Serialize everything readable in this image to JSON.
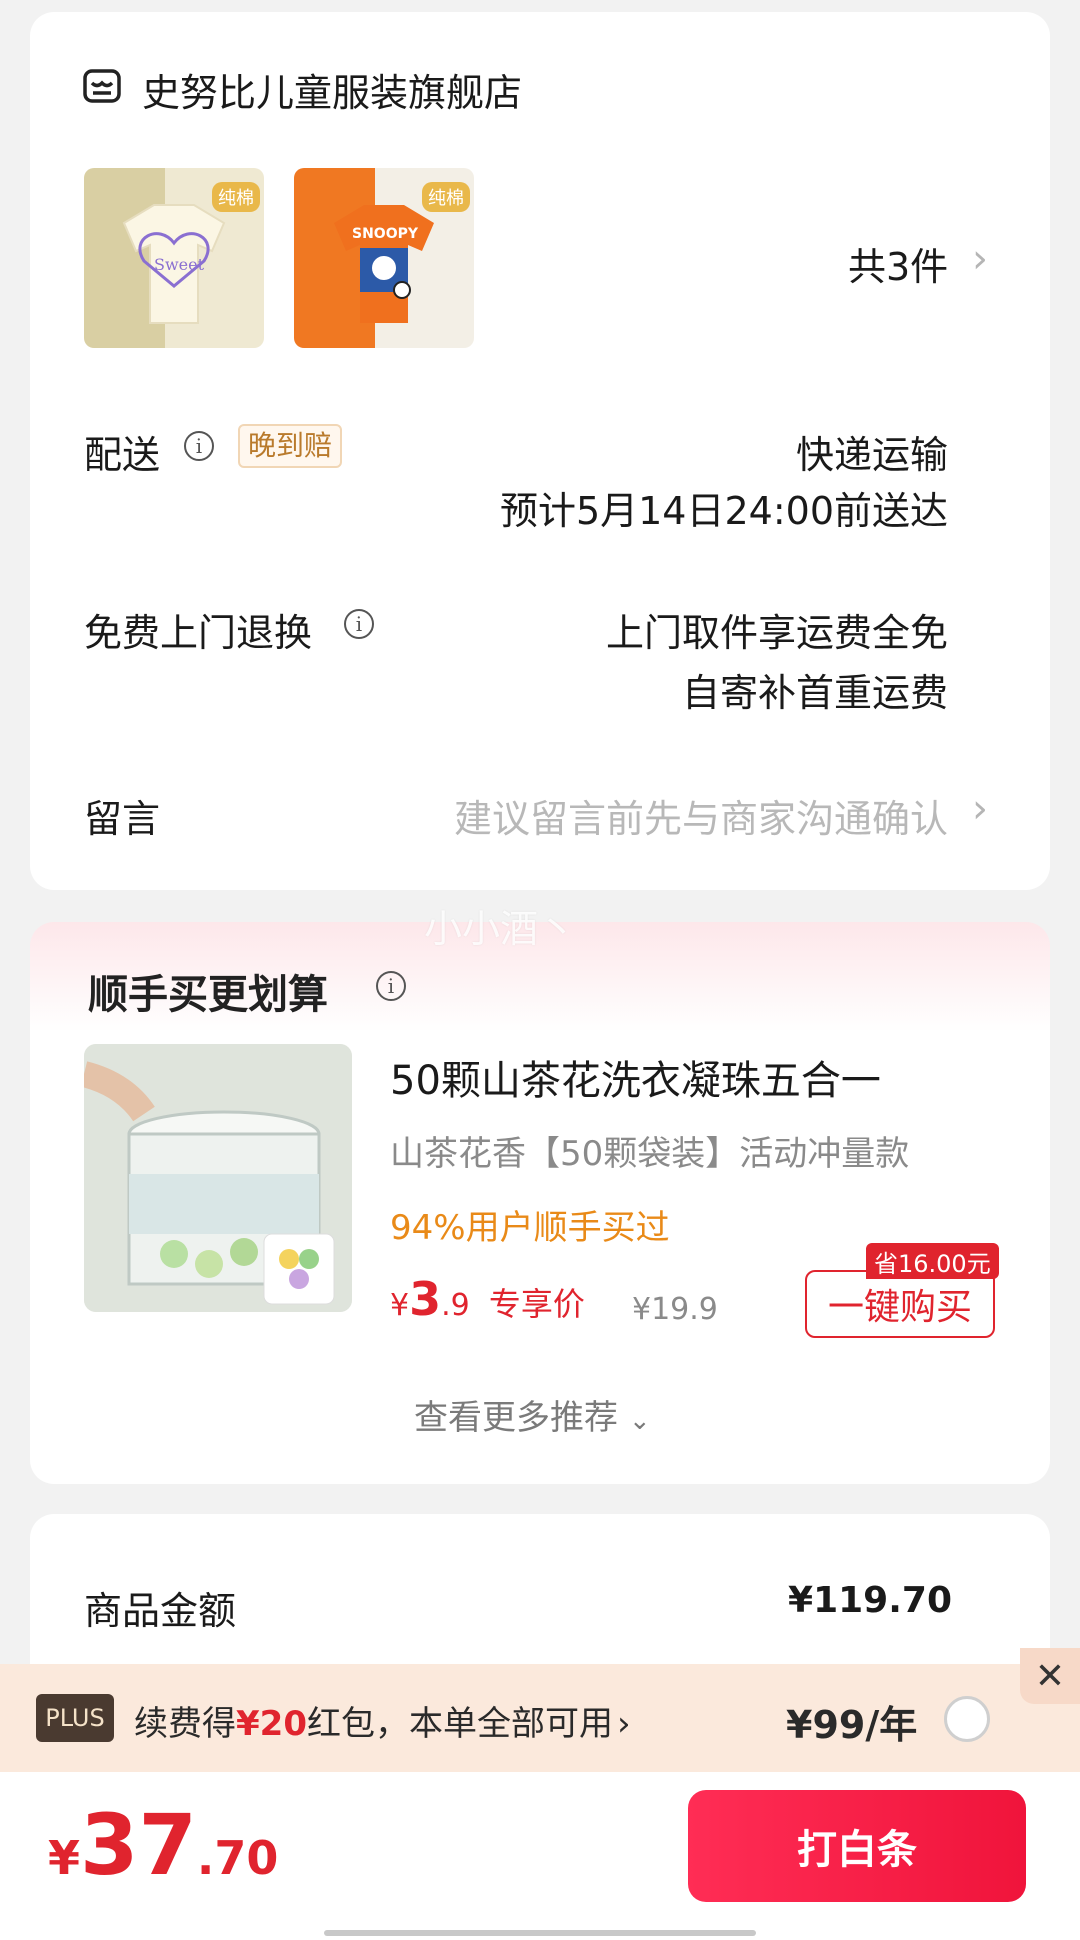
{
  "store": {
    "name": "史努比儿童服装旗舰店",
    "item_count": "共3件",
    "thumb_tag": "纯棉",
    "thumb_brand": "SNOOPY"
  },
  "delivery": {
    "label": "配送",
    "badge": "晚到赔",
    "method": "快递运输",
    "eta": "预计5月14日24:00前送达"
  },
  "returns": {
    "label": "免费上门退换",
    "line1": "上门取件享运费全免",
    "line2": "自寄补首重运费"
  },
  "message": {
    "label": "留言",
    "placeholder": "建议留言前先与商家沟通确认"
  },
  "watermark": "小小酒丶",
  "recommend": {
    "title": "顺手买更划算",
    "product_title": "50颗山茶花洗衣凝珠五合一",
    "variant": "山茶花香【50颗袋装】活动冲量款",
    "social_proof": "94%用户顺手买过",
    "currency": "¥",
    "price_int": "3",
    "price_dec": ".9",
    "price_label": "专享价",
    "original_price": "¥19.9",
    "save_tag": "省16.00元",
    "buy_button": "一键购买",
    "more": "查看更多推荐"
  },
  "summary": {
    "goods_label": "商品金额",
    "goods_amount": "¥119.70"
  },
  "plus": {
    "badge": "PLUS",
    "text_pre": "续费得",
    "text_amount": "¥20",
    "text_post": "红包，本单全部可用",
    "price": "¥99/年"
  },
  "footer": {
    "currency": "¥",
    "total_int": "37",
    "total_dec": ".70",
    "pay_button": "打白条"
  },
  "colors": {
    "accent_red": "#e0242e",
    "orange": "#e98a18",
    "plus_bg": "#fbe9dc"
  }
}
